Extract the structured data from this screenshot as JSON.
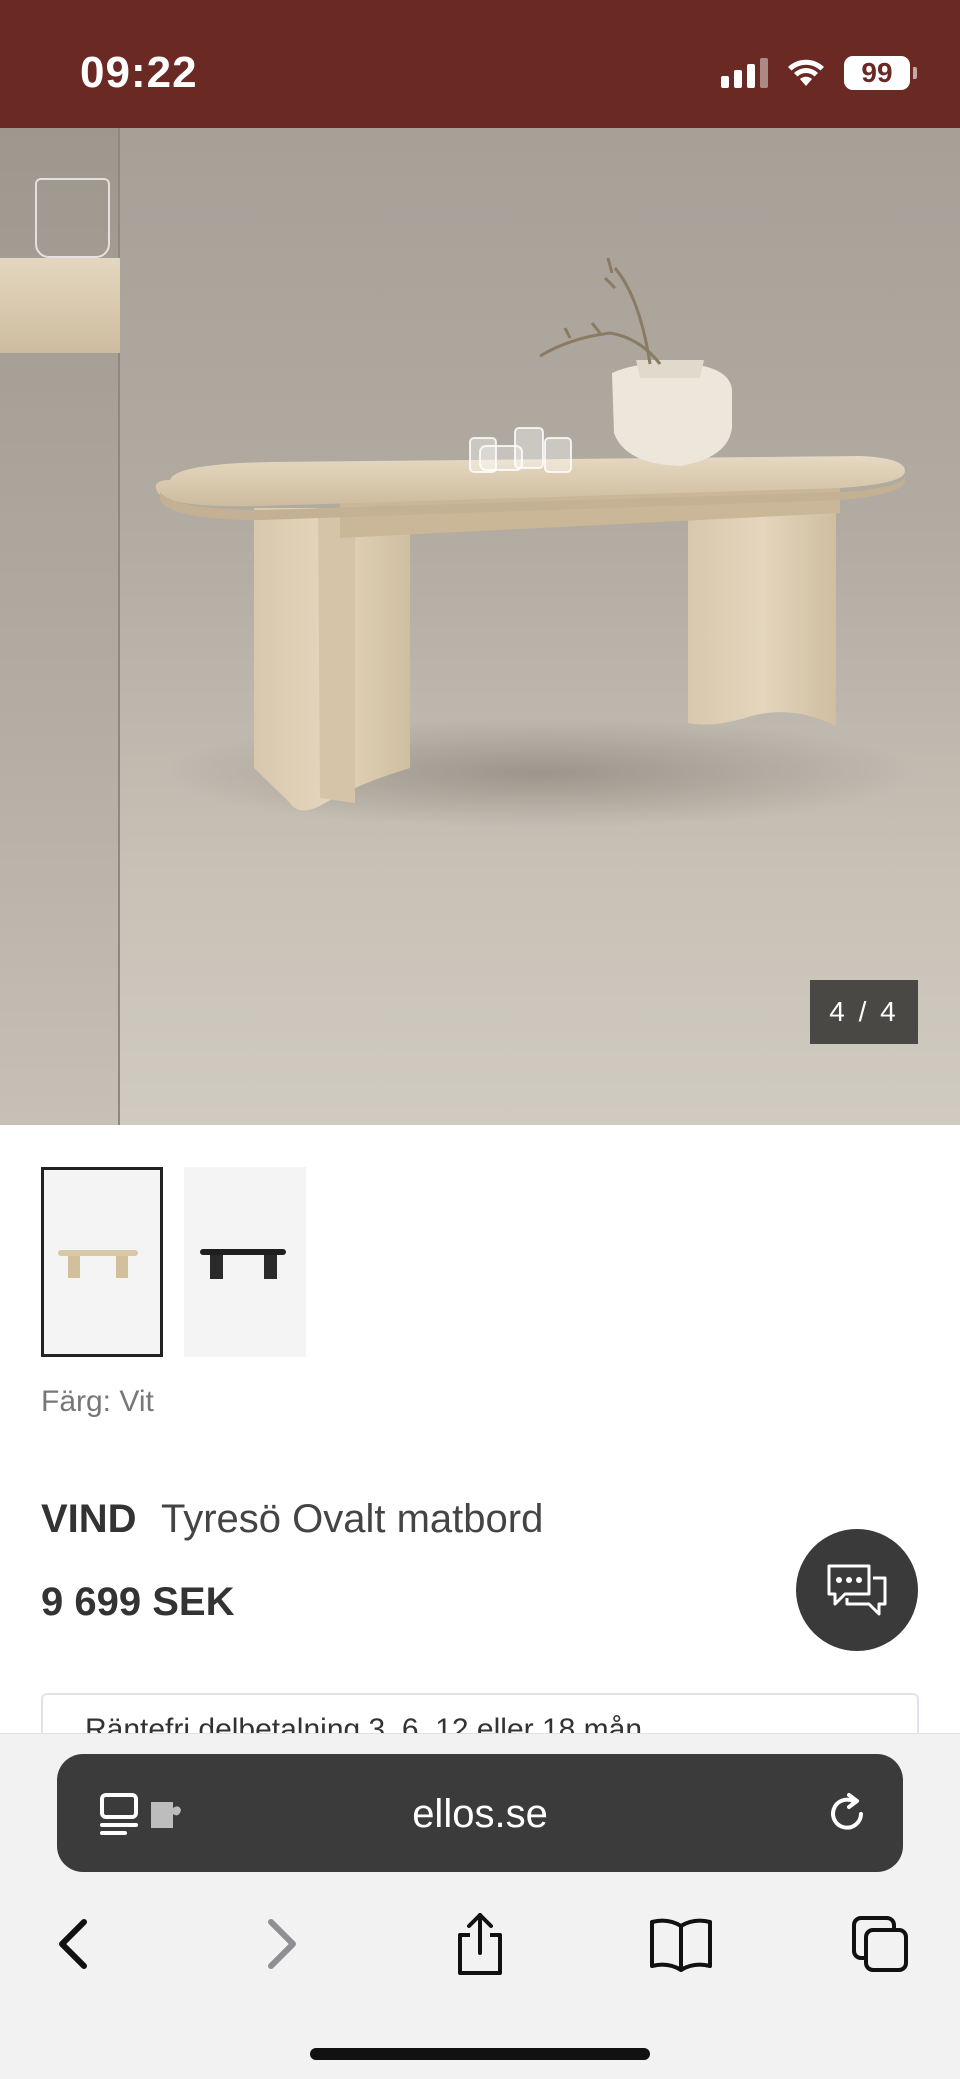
{
  "status_bar": {
    "time": "09:22",
    "battery": "99",
    "icons": [
      "cellular-signal-icon",
      "wifi-icon",
      "battery-icon"
    ],
    "background": "#6b2923"
  },
  "gallery": {
    "counter": "4 / 4",
    "current_index": 4,
    "total": 4
  },
  "thumbnails": [
    {
      "name": "light-oak-table",
      "selected": true
    },
    {
      "name": "black-table",
      "selected": false
    }
  ],
  "product": {
    "color_label": "Färg: Vit",
    "brand": "VIND",
    "name": "Tyresö Ovalt matbord",
    "price": "9 699 SEK",
    "promo": "Räntefri delbetalning 3, 6, 12 eller 18 mån"
  },
  "browser": {
    "url": "ellos.se",
    "toolbar_icons": [
      "back-icon",
      "forward-icon",
      "share-icon",
      "bookmarks-icon",
      "tabs-icon"
    ]
  },
  "colors": {
    "accent": "#6b2923",
    "chat_button": "#3a3a3a",
    "url_bar": "#3b3b3c"
  }
}
